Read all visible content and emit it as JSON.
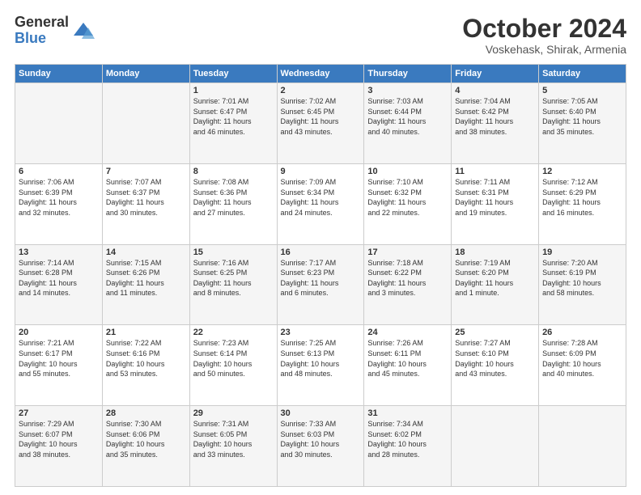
{
  "logo": {
    "general": "General",
    "blue": "Blue"
  },
  "title": "October 2024",
  "location": "Voskehask, Shirak, Armenia",
  "days_header": [
    "Sunday",
    "Monday",
    "Tuesday",
    "Wednesday",
    "Thursday",
    "Friday",
    "Saturday"
  ],
  "weeks": [
    [
      {
        "day": "",
        "detail": ""
      },
      {
        "day": "",
        "detail": ""
      },
      {
        "day": "1",
        "detail": "Sunrise: 7:01 AM\nSunset: 6:47 PM\nDaylight: 11 hours\nand 46 minutes."
      },
      {
        "day": "2",
        "detail": "Sunrise: 7:02 AM\nSunset: 6:45 PM\nDaylight: 11 hours\nand 43 minutes."
      },
      {
        "day": "3",
        "detail": "Sunrise: 7:03 AM\nSunset: 6:44 PM\nDaylight: 11 hours\nand 40 minutes."
      },
      {
        "day": "4",
        "detail": "Sunrise: 7:04 AM\nSunset: 6:42 PM\nDaylight: 11 hours\nand 38 minutes."
      },
      {
        "day": "5",
        "detail": "Sunrise: 7:05 AM\nSunset: 6:40 PM\nDaylight: 11 hours\nand 35 minutes."
      }
    ],
    [
      {
        "day": "6",
        "detail": "Sunrise: 7:06 AM\nSunset: 6:39 PM\nDaylight: 11 hours\nand 32 minutes."
      },
      {
        "day": "7",
        "detail": "Sunrise: 7:07 AM\nSunset: 6:37 PM\nDaylight: 11 hours\nand 30 minutes."
      },
      {
        "day": "8",
        "detail": "Sunrise: 7:08 AM\nSunset: 6:36 PM\nDaylight: 11 hours\nand 27 minutes."
      },
      {
        "day": "9",
        "detail": "Sunrise: 7:09 AM\nSunset: 6:34 PM\nDaylight: 11 hours\nand 24 minutes."
      },
      {
        "day": "10",
        "detail": "Sunrise: 7:10 AM\nSunset: 6:32 PM\nDaylight: 11 hours\nand 22 minutes."
      },
      {
        "day": "11",
        "detail": "Sunrise: 7:11 AM\nSunset: 6:31 PM\nDaylight: 11 hours\nand 19 minutes."
      },
      {
        "day": "12",
        "detail": "Sunrise: 7:12 AM\nSunset: 6:29 PM\nDaylight: 11 hours\nand 16 minutes."
      }
    ],
    [
      {
        "day": "13",
        "detail": "Sunrise: 7:14 AM\nSunset: 6:28 PM\nDaylight: 11 hours\nand 14 minutes."
      },
      {
        "day": "14",
        "detail": "Sunrise: 7:15 AM\nSunset: 6:26 PM\nDaylight: 11 hours\nand 11 minutes."
      },
      {
        "day": "15",
        "detail": "Sunrise: 7:16 AM\nSunset: 6:25 PM\nDaylight: 11 hours\nand 8 minutes."
      },
      {
        "day": "16",
        "detail": "Sunrise: 7:17 AM\nSunset: 6:23 PM\nDaylight: 11 hours\nand 6 minutes."
      },
      {
        "day": "17",
        "detail": "Sunrise: 7:18 AM\nSunset: 6:22 PM\nDaylight: 11 hours\nand 3 minutes."
      },
      {
        "day": "18",
        "detail": "Sunrise: 7:19 AM\nSunset: 6:20 PM\nDaylight: 11 hours\nand 1 minute."
      },
      {
        "day": "19",
        "detail": "Sunrise: 7:20 AM\nSunset: 6:19 PM\nDaylight: 10 hours\nand 58 minutes."
      }
    ],
    [
      {
        "day": "20",
        "detail": "Sunrise: 7:21 AM\nSunset: 6:17 PM\nDaylight: 10 hours\nand 55 minutes."
      },
      {
        "day": "21",
        "detail": "Sunrise: 7:22 AM\nSunset: 6:16 PM\nDaylight: 10 hours\nand 53 minutes."
      },
      {
        "day": "22",
        "detail": "Sunrise: 7:23 AM\nSunset: 6:14 PM\nDaylight: 10 hours\nand 50 minutes."
      },
      {
        "day": "23",
        "detail": "Sunrise: 7:25 AM\nSunset: 6:13 PM\nDaylight: 10 hours\nand 48 minutes."
      },
      {
        "day": "24",
        "detail": "Sunrise: 7:26 AM\nSunset: 6:11 PM\nDaylight: 10 hours\nand 45 minutes."
      },
      {
        "day": "25",
        "detail": "Sunrise: 7:27 AM\nSunset: 6:10 PM\nDaylight: 10 hours\nand 43 minutes."
      },
      {
        "day": "26",
        "detail": "Sunrise: 7:28 AM\nSunset: 6:09 PM\nDaylight: 10 hours\nand 40 minutes."
      }
    ],
    [
      {
        "day": "27",
        "detail": "Sunrise: 7:29 AM\nSunset: 6:07 PM\nDaylight: 10 hours\nand 38 minutes."
      },
      {
        "day": "28",
        "detail": "Sunrise: 7:30 AM\nSunset: 6:06 PM\nDaylight: 10 hours\nand 35 minutes."
      },
      {
        "day": "29",
        "detail": "Sunrise: 7:31 AM\nSunset: 6:05 PM\nDaylight: 10 hours\nand 33 minutes."
      },
      {
        "day": "30",
        "detail": "Sunrise: 7:33 AM\nSunset: 6:03 PM\nDaylight: 10 hours\nand 30 minutes."
      },
      {
        "day": "31",
        "detail": "Sunrise: 7:34 AM\nSunset: 6:02 PM\nDaylight: 10 hours\nand 28 minutes."
      },
      {
        "day": "",
        "detail": ""
      },
      {
        "day": "",
        "detail": ""
      }
    ]
  ]
}
